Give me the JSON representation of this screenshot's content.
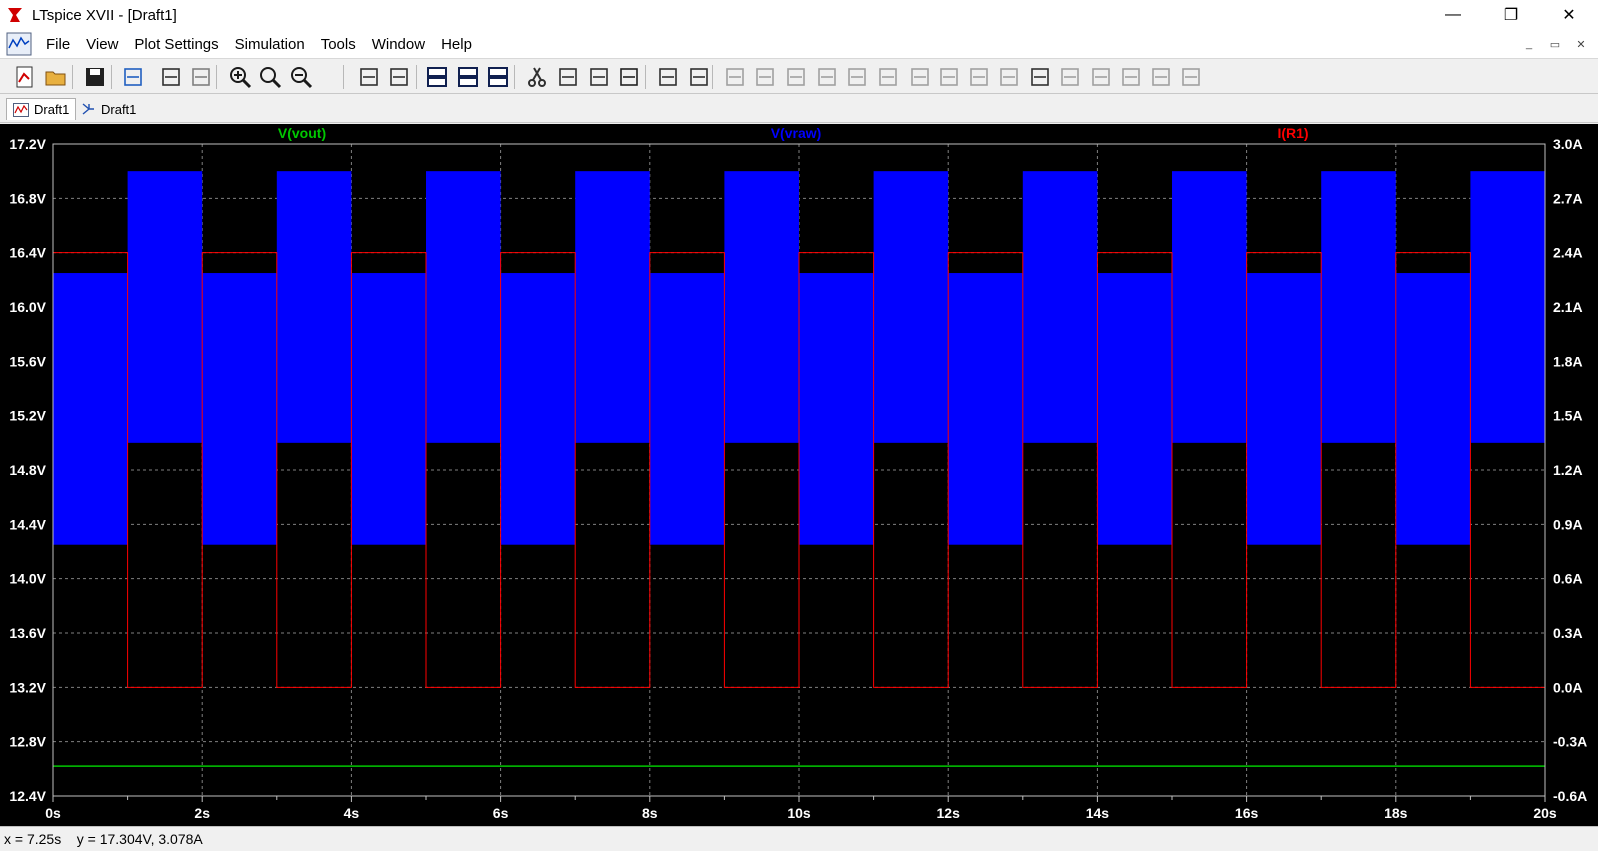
{
  "window": {
    "title": "LTspice XVII - [Draft1]",
    "minimize_glyph": "—",
    "restore_glyph": "❐",
    "close_glyph": "✕"
  },
  "menu": {
    "items": [
      "File",
      "View",
      "Plot Settings",
      "Simulation",
      "Tools",
      "Window",
      "Help"
    ],
    "mdi_minimize": "_",
    "mdi_restore": "▭",
    "mdi_close": "✕"
  },
  "toolbar": {
    "icons": [
      "new-schematic-icon",
      "open-icon",
      "save-icon",
      "control-panel-icon",
      "run-icon",
      "halt-icon",
      "zoom-in-icon",
      "zoom-area-icon",
      "zoom-out-icon",
      "autorange-icon",
      "pick-visible-traces-icon",
      "tile-horizontal-icon",
      "tile-vertical-icon",
      "cascade-icon",
      "cut-icon",
      "copy-icon",
      "paste-icon",
      "find-icon",
      "print-icon",
      "print-setup-icon",
      "wire-icon",
      "ground-icon",
      "label-net-icon",
      "resistor-icon",
      "capacitor-icon",
      "inductor-icon",
      "diode-icon",
      "component-icon",
      "move-icon",
      "drag-icon",
      "undo-icon",
      "redo-icon",
      "rotate-icon",
      "mirror-icon",
      "text-icon",
      "spice-directive-icon"
    ]
  },
  "tabs": [
    {
      "label": "Draft1",
      "type": "waveform",
      "active": true
    },
    {
      "label": "Draft1",
      "type": "schematic",
      "active": false
    }
  ],
  "status": {
    "readout": "x = 7.25s    y = 17.304V, 3.078A"
  },
  "chart_data": {
    "type": "line",
    "title": "",
    "traces": [
      {
        "name": "V(vout)",
        "color": "#00c800",
        "axis": "left"
      },
      {
        "name": "V(vraw)",
        "color": "#0000ff",
        "axis": "left"
      },
      {
        "name": "I(R1)",
        "color": "#ff0000",
        "axis": "right"
      }
    ],
    "x_axis": {
      "min": 0,
      "max": 20,
      "unit": "s",
      "ticks": [
        "0s",
        "2s",
        "4s",
        "6s",
        "8s",
        "10s",
        "12s",
        "14s",
        "16s",
        "18s",
        "20s"
      ],
      "minor_step": 1
    },
    "y_left": {
      "min": 12.4,
      "max": 17.2,
      "unit": "V",
      "ticks": [
        "17.2V",
        "16.8V",
        "16.4V",
        "16.0V",
        "15.6V",
        "15.2V",
        "14.8V",
        "14.4V",
        "14.0V",
        "13.6V",
        "13.2V",
        "12.8V",
        "12.4V"
      ]
    },
    "y_right": {
      "min": -0.6,
      "max": 3.0,
      "unit": "A",
      "ticks": [
        "3.0A",
        "2.7A",
        "2.4A",
        "2.1A",
        "1.8A",
        "1.5A",
        "1.2A",
        "0.9A",
        "0.6A",
        "0.3A",
        "0.0A",
        "-0.3A",
        "-0.6A"
      ]
    },
    "grid": true,
    "period_s": 2,
    "vraw_band": {
      "first_half": {
        "low": 14.25,
        "high": 16.25
      },
      "second_half": {
        "low": 15.0,
        "high": 17.0
      }
    },
    "ir1_levels": {
      "first_half": 2.4,
      "second_half": 0.0
    },
    "vout_level": 12.62,
    "background": "#000000",
    "grid_color": "#808080",
    "label_color": "#ffffff"
  }
}
